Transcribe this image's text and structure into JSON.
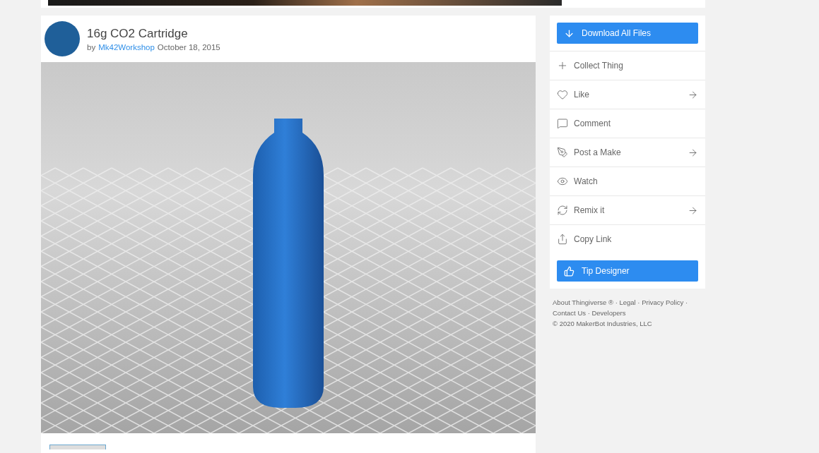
{
  "thing": {
    "title": "16g CO2 Cartridge",
    "by": "by",
    "author": "Mk42Workshop",
    "date": "October 18, 2015"
  },
  "actions": [
    {
      "kind": "primary",
      "label": "Download All Files"
    },
    {
      "kind": "item",
      "label": "Collect Thing",
      "arrow": false
    },
    {
      "kind": "item",
      "label": "Like",
      "arrow": true
    },
    {
      "kind": "item",
      "label": "Comment",
      "arrow": false
    },
    {
      "kind": "item",
      "label": "Post a Make",
      "arrow": true
    },
    {
      "kind": "item",
      "label": "Watch",
      "arrow": false
    },
    {
      "kind": "item",
      "label": "Remix it",
      "arrow": true
    },
    {
      "kind": "item",
      "label": "Copy Link",
      "arrow": false
    },
    {
      "kind": "primary",
      "label": "Tip Designer"
    }
  ],
  "footer": {
    "lines": [
      "About Thingiverse ® · Legal · Privacy Policy ·",
      "Contact Us · Developers"
    ],
    "copyright": "©  2020 MakerBot Industries, LLC"
  }
}
